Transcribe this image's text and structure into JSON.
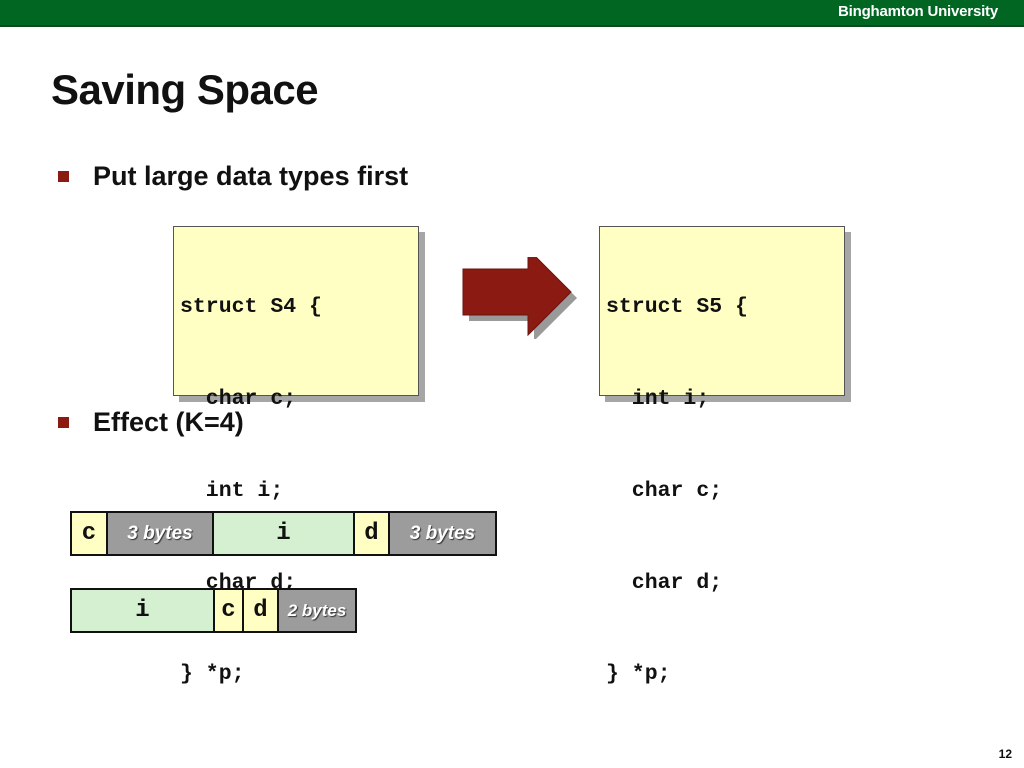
{
  "header": {
    "institution": "Binghamton University",
    "bar_color": "#006622"
  },
  "slide": {
    "title": "Saving Space",
    "page_number": "12",
    "bullets": [
      "Put large data types first",
      "Effect (K=4)"
    ]
  },
  "code_before": {
    "lines": [
      "struct S4 {",
      "  char c;",
      "  int i;",
      "  char d;",
      "} *p;"
    ]
  },
  "code_after": {
    "lines": [
      "struct S5 {",
      "  int i;",
      "  char c;",
      "  char d;",
      "} *p;"
    ]
  },
  "layout_s4": {
    "cells": [
      {
        "label": "c",
        "kind": "char",
        "bytes": 1
      },
      {
        "label": "3 bytes",
        "kind": "padding",
        "bytes": 3
      },
      {
        "label": "i",
        "kind": "int",
        "bytes": 4
      },
      {
        "label": "d",
        "kind": "char",
        "bytes": 1
      },
      {
        "label": "3 bytes",
        "kind": "padding",
        "bytes": 3
      }
    ]
  },
  "layout_s5": {
    "cells": [
      {
        "label": "i",
        "kind": "int",
        "bytes": 4
      },
      {
        "label": "c",
        "kind": "char",
        "bytes": 1
      },
      {
        "label": "d",
        "kind": "char",
        "bytes": 1
      },
      {
        "label": "2 bytes",
        "kind": "padding",
        "bytes": 2
      }
    ]
  },
  "colors": {
    "bullet": "#8b1a12",
    "arrow": "#8b1a12",
    "char_fill": "#ffffc4",
    "int_fill": "#d4f0d0",
    "padding_fill": "#9c9c9c"
  },
  "icons": {
    "bullet": "square-bullet",
    "transform": "right-arrow-icon"
  }
}
